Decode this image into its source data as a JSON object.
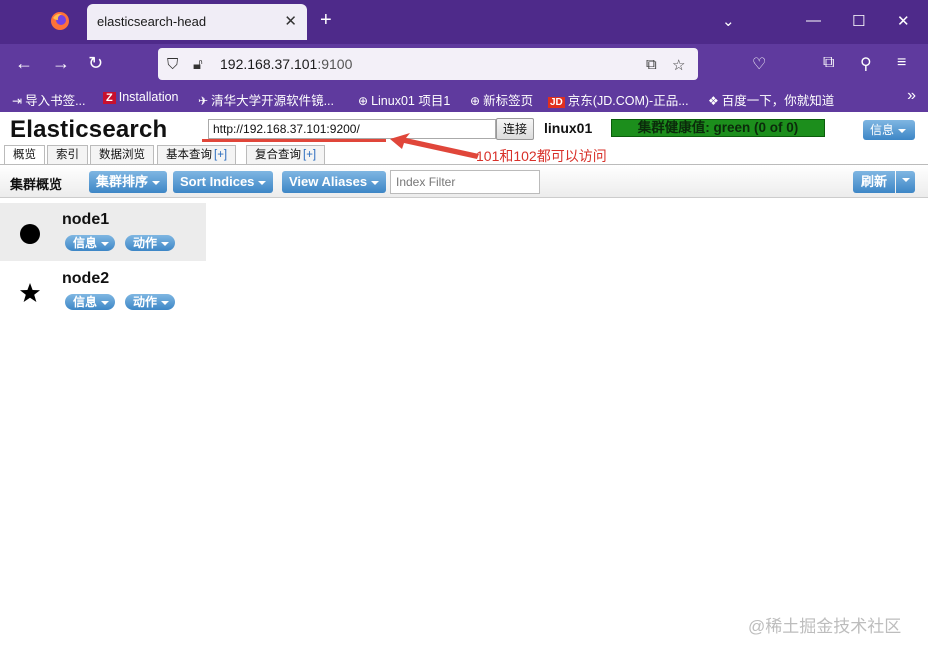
{
  "browser": {
    "tab_title": "elasticsearch-head",
    "url_host": "192.168.37.101",
    "url_port": ":9100",
    "bookmarks": [
      "导入书签...",
      "Installation",
      "清华大学开源软件镜...",
      "Linux01 项目1",
      "新标签页",
      "京东(JD.COM)-正品...",
      "百度一下，你就知道"
    ],
    "bookmark_jd_badge": "JD",
    "bookmark_z_badge": "Z"
  },
  "header": {
    "app_title": "Elasticsearch",
    "connection_url": "http://192.168.37.101:9200/",
    "connect_label": "连接",
    "cluster_name": "linux01",
    "health_text": "集群健康值: green (0 of 0)",
    "info_label": "信息"
  },
  "annotation": {
    "note": "101和102都可以访问",
    "color": "#d8312a"
  },
  "tabs": [
    {
      "label": "概览"
    },
    {
      "label": "索引"
    },
    {
      "label": "数据浏览"
    },
    {
      "label": "基本查询",
      "suffix": "[+]"
    },
    {
      "label": "复合查询",
      "suffix": "[+]"
    }
  ],
  "toolbar": {
    "title": "集群概览",
    "sort_cluster": "集群排序",
    "sort_indices": "Sort Indices",
    "view_aliases": "View Aliases",
    "filter_placeholder": "Index Filter",
    "refresh": "刷新"
  },
  "nodes": [
    {
      "name": "node1",
      "marker": "circle",
      "info": "信息",
      "action": "动作"
    },
    {
      "name": "node2",
      "marker": "star",
      "info": "信息",
      "action": "动作"
    }
  ],
  "watermark": "@稀土掘金技术社区",
  "colors": {
    "tabbar": "#4e2a8a",
    "navbar": "#5f3a9e",
    "health_green": "#1c8e1c",
    "button_blue": "#3d86c6"
  }
}
